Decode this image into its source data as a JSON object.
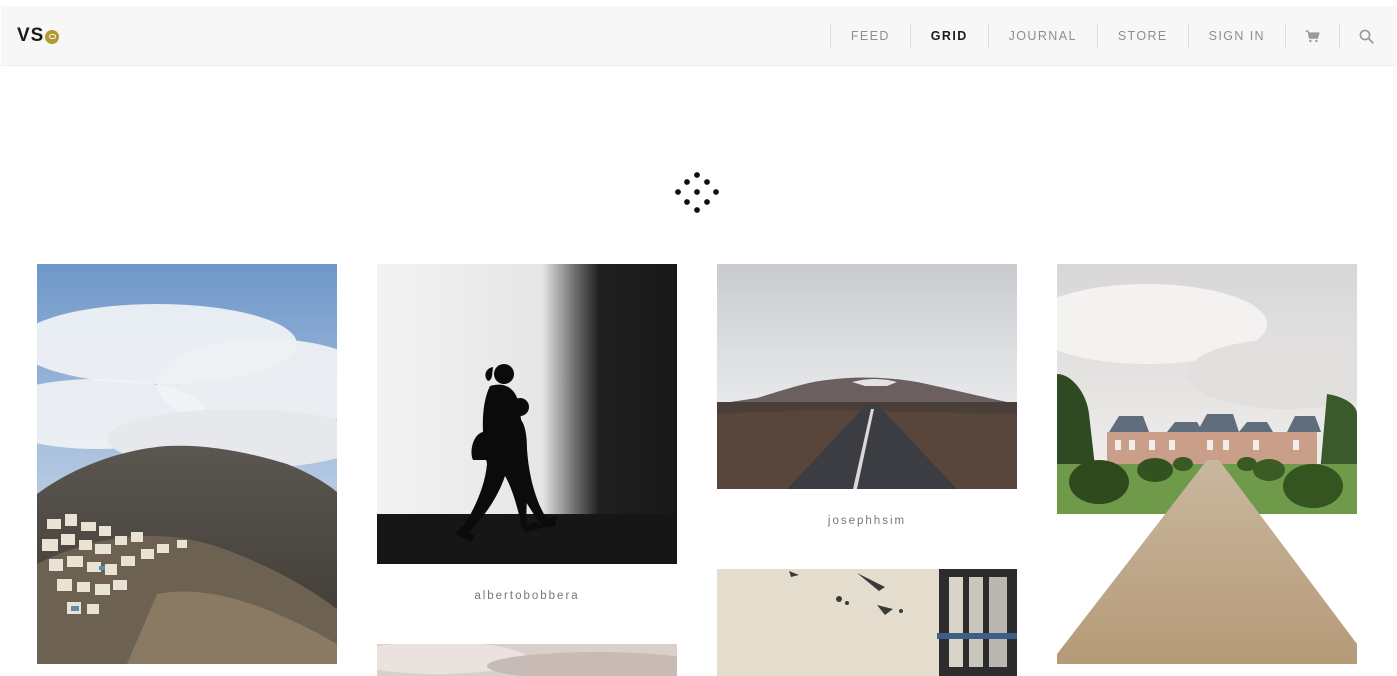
{
  "logo": {
    "text": "VS",
    "badge_color": "#b49a2e"
  },
  "nav": {
    "items": [
      {
        "label": "FEED",
        "active": false
      },
      {
        "label": "GRID",
        "active": true
      },
      {
        "label": "JOURNAL",
        "active": false
      },
      {
        "label": "STORE",
        "active": false
      },
      {
        "label": "SIGN IN",
        "active": false
      }
    ],
    "icons": [
      "cart-icon",
      "search-icon"
    ]
  },
  "loader": {
    "icon": "loading-dots-icon"
  },
  "grid": {
    "images": [
      {
        "name": "mountain-village-photo"
      },
      {
        "name": "walking-silhouette-photo",
        "caption": "albertobobbera"
      },
      {
        "name": "mountain-road-photo",
        "caption": "josephhsim"
      },
      {
        "name": "chateau-garden-photo"
      },
      {
        "name": "cloudy-sky-photo"
      },
      {
        "name": "wall-window-photo"
      }
    ]
  },
  "colors": {
    "topbar": "#f7f7f7",
    "accent": "#b49a2e",
    "text_muted": "#8e8e8e"
  }
}
